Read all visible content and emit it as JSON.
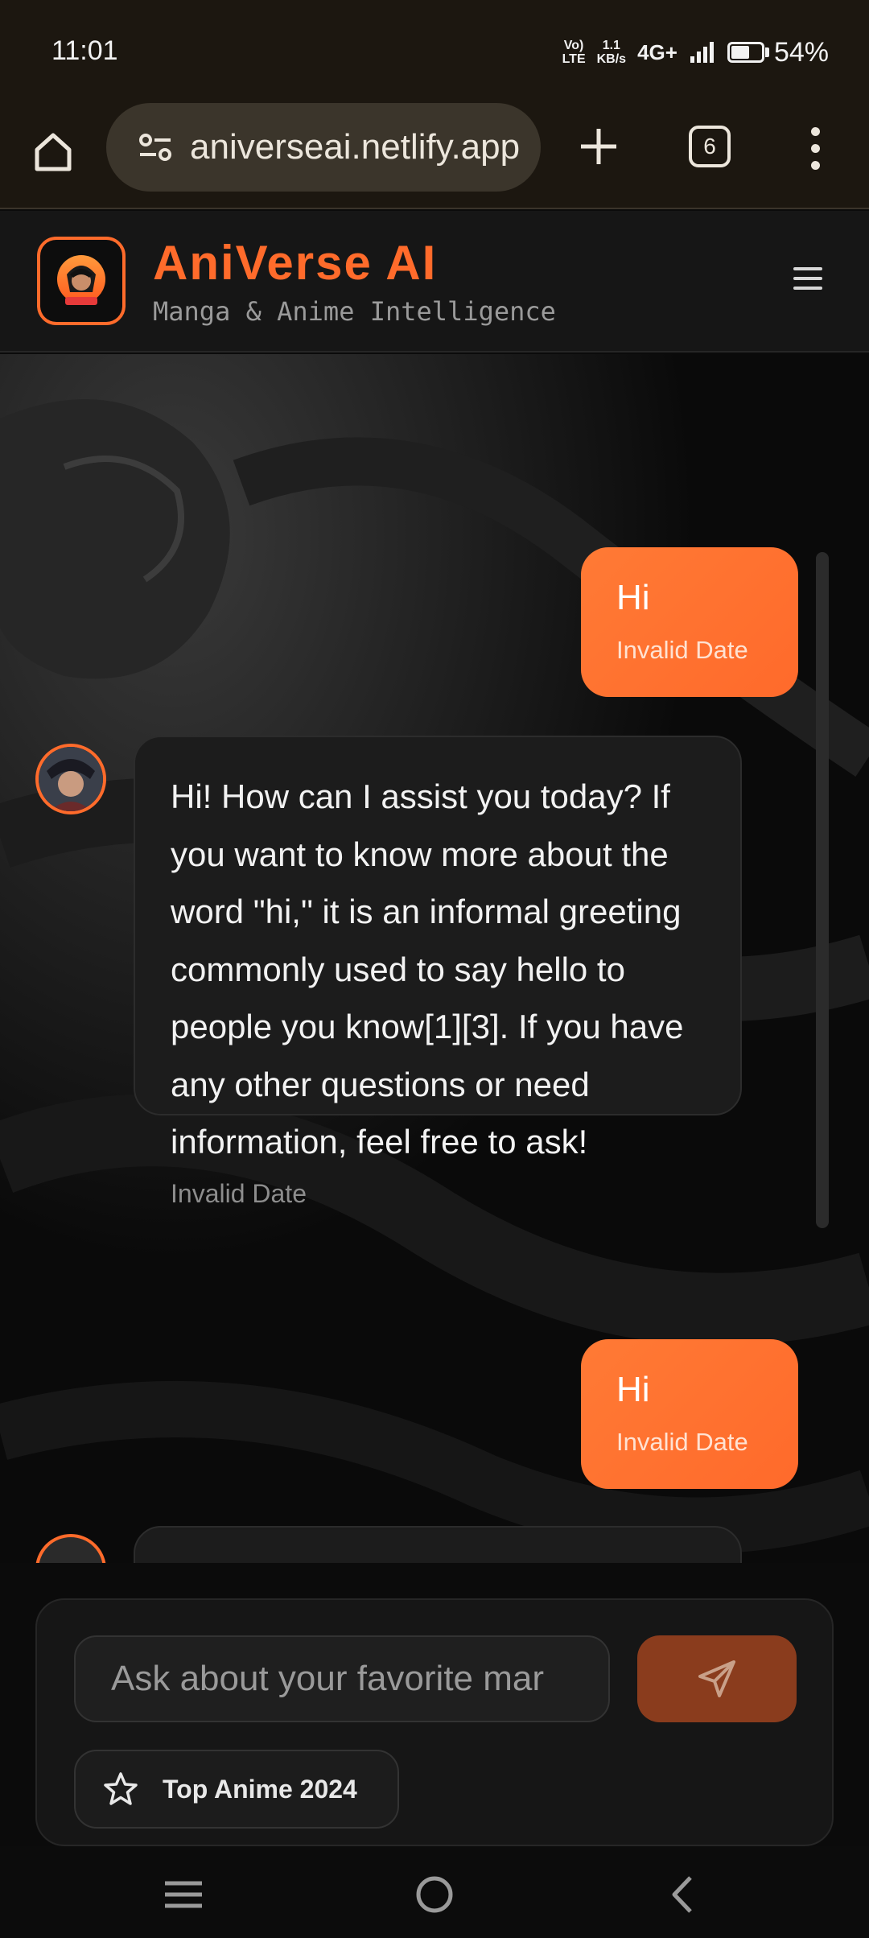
{
  "status_bar": {
    "time": "11:01",
    "volte": "Vo) LTE",
    "speed_value": "1.1",
    "speed_unit": "KB/s",
    "network": "4G+",
    "battery": "54%",
    "battery_level": 0.54
  },
  "browser": {
    "url": "aniverseai.netlify.app",
    "tab_count": "6"
  },
  "app": {
    "title": "AniVerse AI",
    "subtitle": "Manga & Anime Intelligence",
    "logo_caption": "AniVerse AI",
    "accent_color": "#ff6b2b"
  },
  "messages": [
    {
      "role": "user",
      "text": "Hi",
      "time": "Invalid Date"
    },
    {
      "role": "assistant",
      "text": "Hi! How can I assist you today? If you want to know more about the word \"hi,\" it is an informal greeting commonly used to say hello to people you know[1][3]. If you have any other questions or need information, feel free to ask!",
      "time": "Invalid Date"
    },
    {
      "role": "user",
      "text": "Hi",
      "time": "Invalid Date"
    }
  ],
  "composer": {
    "placeholder": "Ask about your favorite mar",
    "suggestion": "Top Anime 2024",
    "suggestion_icon": "star-icon",
    "send_icon": "send-icon"
  },
  "nav": {
    "icons": [
      "recents-icon",
      "home-circle-icon",
      "back-icon"
    ]
  }
}
